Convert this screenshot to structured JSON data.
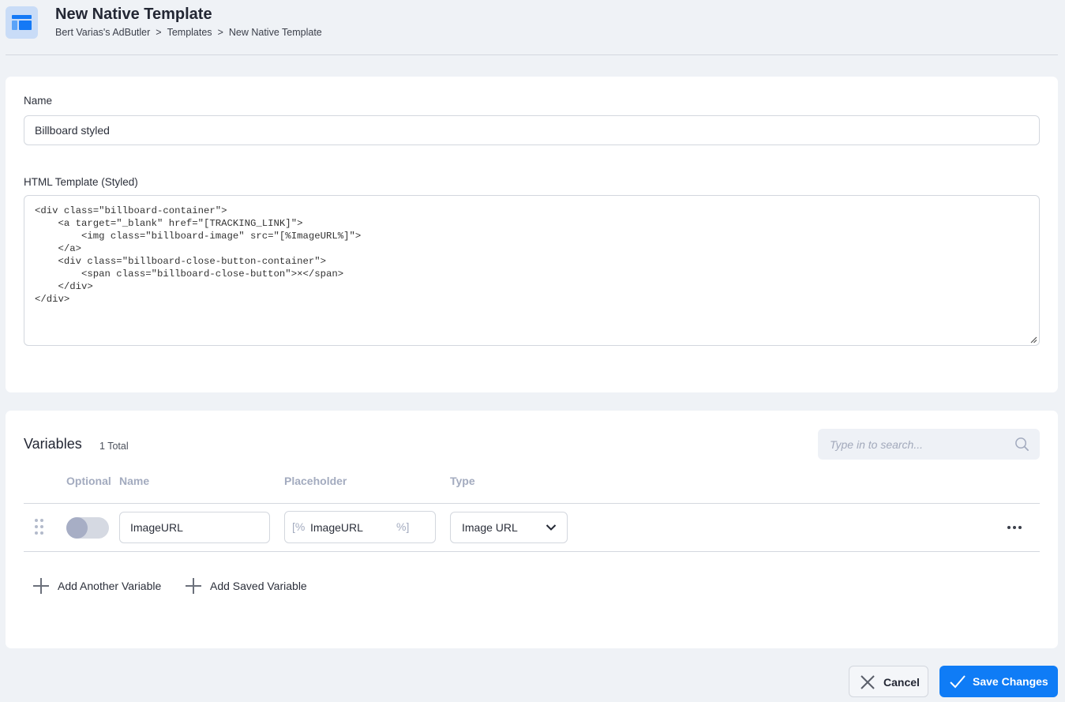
{
  "header": {
    "icon": "template-layout-icon",
    "title": "New Native Template",
    "breadcrumb": [
      "Bert Varias's AdButler",
      ">",
      "Templates",
      ">",
      "New Native Template"
    ]
  },
  "form": {
    "name_label": "Name",
    "name_value": "Billboard styled",
    "template_label": "HTML Template (Styled)",
    "template_value": "<div class=\"billboard-container\">\n    <a target=\"_blank\" href=\"[TRACKING_LINK]\">\n        <img class=\"billboard-image\" src=\"[%ImageURL%]\">\n    </a>\n    <div class=\"billboard-close-button-container\">\n        <span class=\"billboard-close-button\">×</span>\n    </div>\n</div>"
  },
  "variables": {
    "title": "Variables",
    "count": "1 Total",
    "search_placeholder": "Type in to search...",
    "columns": [
      "Optional",
      "Name",
      "Placeholder",
      "Type"
    ],
    "rows": [
      {
        "optional": false,
        "name": "ImageURL",
        "placeholder_prefix": "[%",
        "placeholder": "ImageURL",
        "placeholder_suffix": "%]",
        "type": "Image URL"
      }
    ],
    "add_another_label": "Add Another Variable",
    "add_saved_label": "Add Saved Variable"
  },
  "footer": {
    "cancel_label": "Cancel",
    "save_label": "Save Changes"
  },
  "colors": {
    "accent": "#0f7cf6",
    "background": "#eff2f6",
    "muted_text": "#a3abbf"
  }
}
